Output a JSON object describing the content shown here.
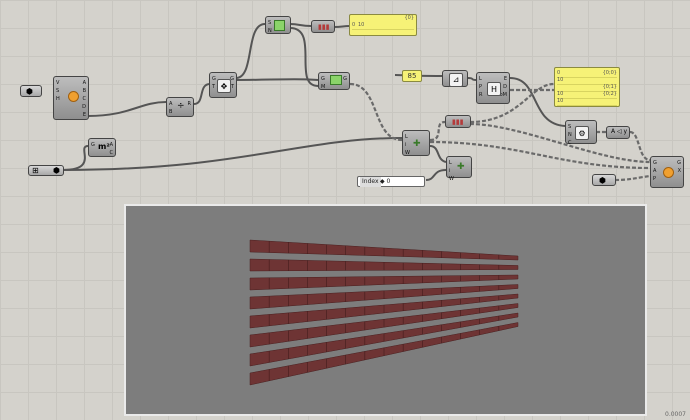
{
  "canvas": {
    "grid_color": "#c8c6c0",
    "background_color": "#d4d2cc"
  },
  "panels": {
    "top_panel": {
      "header_index": "{0}",
      "rows": [
        {
          "index": "0",
          "value": "10"
        }
      ]
    },
    "list_panel": {
      "rows": [
        {
          "index": "0",
          "path": "{0;0}",
          "value": "10"
        },
        {
          "index": "0",
          "path": "{0;1}",
          "value": "10"
        },
        {
          "index": "0",
          "path": "{0;2}",
          "value": "10"
        }
      ]
    }
  },
  "number_input": {
    "value": "85"
  },
  "slider": {
    "label": "Index",
    "value": "◆ 0"
  },
  "components": {
    "orange": {
      "ports_left": [
        "V",
        "S",
        "H"
      ],
      "ports_right": [
        "A",
        "B",
        "C",
        "D",
        "E",
        "F"
      ]
    },
    "area": {
      "ports_left": [
        "G"
      ],
      "ports_right": [
        "A",
        "C"
      ]
    },
    "divide": {
      "ports_left": [
        "A",
        "B"
      ],
      "ports_right": [
        "R"
      ]
    },
    "move": {
      "ports_left": [
        "G",
        "T"
      ],
      "ports_right": [
        "G",
        "T"
      ]
    },
    "mirror": {
      "ports_left": [
        "G",
        "M"
      ],
      "ports_right": [
        "G",
        "M"
      ]
    },
    "list_item": {
      "ports_left": [
        "L",
        "i",
        "W"
      ],
      "ports_right": [
        "E"
      ]
    },
    "series": {
      "ports_left": [
        "S",
        "N",
        "C"
      ],
      "ports_right": [
        "S"
      ]
    },
    "merge": {
      "ports_left": [
        "A",
        "B"
      ],
      "ports_right": [
        "R"
      ]
    }
  },
  "viewport": {
    "corner_label": "0.0007",
    "bg_color": "#7d7d7d",
    "brick_color": "#6e3434"
  }
}
